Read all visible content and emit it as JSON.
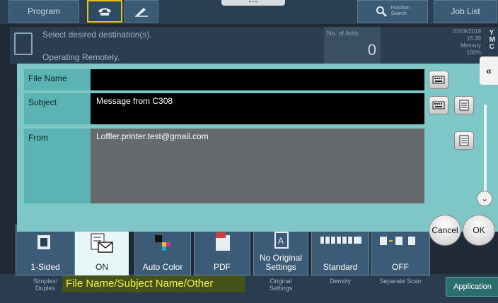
{
  "topbar": {
    "program_label": "Program",
    "function_search_label": "Function\nSearch",
    "job_list_label": "Job List"
  },
  "status": {
    "line1": "Select desired destination(s).",
    "line2": "Operating Remotely.",
    "no_of_addr_label": "No. of Addr.",
    "no_of_addr_value": "0",
    "date": "07/09/2019",
    "time": "15:30",
    "memory_label": "Memory",
    "memory_value": "100%",
    "toner_letters": "Y\nM\nC"
  },
  "dialog": {
    "file_name_label": "File Name",
    "file_name_value": "",
    "subject_label": "Subject",
    "subject_value": "Message from C308",
    "from_label": "From",
    "from_value": "Loffler.printer.test@gmail.com"
  },
  "tiles": {
    "simplex_label": "1-Sided",
    "simplex_sub": "Simplex/\nDuplex",
    "filename_label": "ON",
    "color_label": "Auto Color",
    "filetype_label": "PDF",
    "original_label": "No Original\nSettings",
    "original_sub": "Original\nSettings",
    "density_label": "Standard",
    "density_sub": "Density",
    "separate_label": "OFF",
    "separate_sub": "Separate Scan"
  },
  "tooltip": "File Name/Subject Name/Other",
  "buttons": {
    "cancel": "Cancel",
    "ok": "OK",
    "application": "Application"
  },
  "colors": {
    "dialog_bg": "#7fc7c7",
    "label_bg": "#5cb3b3",
    "tooltip_text": "#f3f04a"
  },
  "icons": [
    "phone-icon",
    "pen-icon",
    "search-icon",
    "keyboard-icon",
    "list-icon",
    "collapse-arrow-icon",
    "chevron-down-icon"
  ]
}
